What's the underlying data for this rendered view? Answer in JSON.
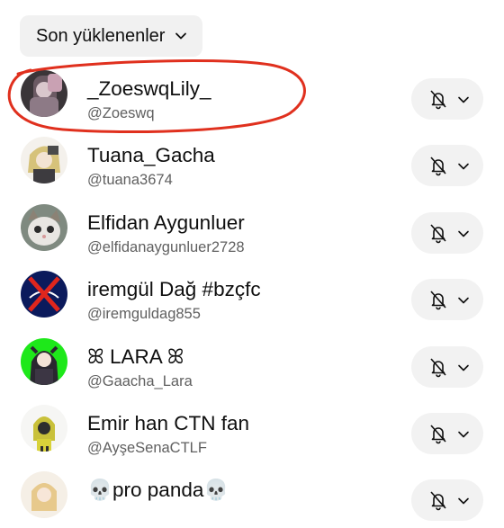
{
  "sort": {
    "label": "Son yüklenenler",
    "icon": "chevron-down-icon"
  },
  "channels": [
    {
      "name": "_ZoeswqLily_",
      "handle": "@Zoeswq",
      "bell_icon": "bell-off-icon"
    },
    {
      "name": "Tuana_Gacha",
      "handle": "@tuana3674",
      "bell_icon": "bell-off-icon"
    },
    {
      "name": "Elfidan Aygunluer",
      "handle": "@elfidanaygunluer2728",
      "bell_icon": "bell-off-icon"
    },
    {
      "name": "iremgül Dağ #bzçfc",
      "handle": "@iremguldag855",
      "bell_icon": "bell-off-icon"
    },
    {
      "name": "ꕤ LARA ꕤ",
      "handle": "@Gaacha_Lara",
      "bell_icon": "bell-off-icon"
    },
    {
      "name": "Emir han CTN fan",
      "handle": "@AyşeSenaCTLF",
      "bell_icon": "bell-off-icon"
    },
    {
      "name": "💀pro panda💀",
      "handle": "",
      "bell_icon": "bell-off-icon"
    }
  ],
  "colors": {
    "highlight_stroke": "#e0301e",
    "chip_bg": "#f1f1f1",
    "handle_text": "#606060"
  }
}
